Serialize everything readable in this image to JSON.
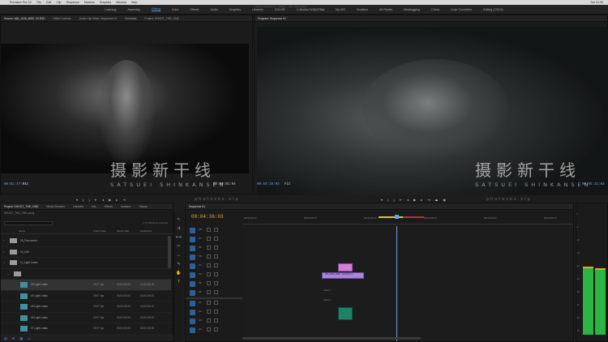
{
  "menubar": {
    "app_name": "Premiere Pro CC",
    "items": [
      "File",
      "Edit",
      "Clip",
      "Sequence",
      "Markers",
      "Graphics",
      "Window",
      "Help"
    ],
    "clock": "Tue 21:06"
  },
  "workspaces": {
    "tabs": [
      "Learning",
      "Assembly",
      "Editing",
      "Color",
      "Effects",
      "Audio",
      "Graphics",
      "Libraries",
      "COLOR",
      "X-Monitor WIDAFINal",
      "My WS",
      "Hoodlum",
      "All Panels",
      "Metalogging",
      "2 Area",
      "Color Correction",
      "Editing (CS5.5)"
    ],
    "active_index": 2,
    "project_path": "/Volumes/Hardrive/../SHOOT_THE_ONE.prproj"
  },
  "source_panel": {
    "tabs": [
      "Source: 486_1006_8000..00.R3D",
      "Effect Controls",
      "Audio Clip Mixer: Sequence 01",
      "Metadata",
      "Project: SHOOT_THE_ONE"
    ],
    "timecode_in": "00:01:47:04",
    "fit": "Fit",
    "timecode_duration": "00:00:01:04"
  },
  "program_panel": {
    "tab": "Program: Sequence 01",
    "timecode": "00:04:36:03",
    "fit": "Fit",
    "timecode_end": "00:05:21:03"
  },
  "watermark": {
    "cn": "摄影新干线",
    "en": "SATSUEI SHINKANSEN",
    "url": "photosks.vip"
  },
  "project_panel": {
    "tabs": [
      "Project: SHOOT_THE_ONE",
      "Media Browser",
      "Libraries",
      "Info",
      "Effects",
      "Markers",
      "History"
    ],
    "path": "SHOOT_THE_ONE.prproj",
    "count": "1 of 108 items selected",
    "columns": [
      "Name",
      "Frame Rate",
      "Media Start",
      "Media End"
    ],
    "rows": [
      {
        "type": "folder",
        "name": "05_Preconvert",
        "fr": "",
        "start": "",
        "end": "",
        "indent": 0
      },
      {
        "type": "folder",
        "name": "10_Edit",
        "fr": "",
        "start": "",
        "end": "",
        "indent": 0
      },
      {
        "type": "folder",
        "name": "11_Light Leaks",
        "fr": "",
        "start": "",
        "end": "",
        "indent": 0
      },
      {
        "type": "folder",
        "name": "",
        "fr": "",
        "start": "",
        "end": "",
        "indent": 1
      },
      {
        "type": "clip",
        "name": "03 Light Leaks",
        "fr": "29.97 fps",
        "start": "00;00;00;00",
        "end": "00;00;05;15",
        "indent": 2
      },
      {
        "type": "clip",
        "name": "04 Light Leaks",
        "fr": "29.97 fps",
        "start": "00;00;00;00",
        "end": "00;00;05;23",
        "indent": 2
      },
      {
        "type": "clip",
        "name": "05 Light Leaks",
        "fr": "29.97 fps",
        "start": "00;00;00;00",
        "end": "00;00;06;10",
        "indent": 2
      },
      {
        "type": "clip",
        "name": "06 Light Leaks",
        "fr": "29.97 fps",
        "start": "00;00;00;00",
        "end": "00;00;05;09",
        "indent": 2
      },
      {
        "type": "clip",
        "name": "07 Light Leaks",
        "fr": "29.97 fps",
        "start": "00;00;00;00",
        "end": "00;00;05;28",
        "indent": 2
      }
    ],
    "selected_row": 4
  },
  "timeline": {
    "tab": "Sequence 01",
    "timecode": "00:04:36:03",
    "ruler_ticks": [
      "00:04:20:17",
      "00:04:26:17",
      "00:04:32:17",
      "00:04:38:17",
      "00:04:44:17",
      "00:04:50:17",
      "00:04:56:17"
    ],
    "video_tracks": [
      "V8",
      "V7",
      "V6",
      "V5",
      "V4",
      "V3",
      "V2",
      "V1"
    ],
    "audio_tracks": [
      "A1",
      "A2",
      "A3",
      "A4",
      "A5",
      "A6",
      "A7"
    ],
    "clip_label": "486_1006_8000...00.R3D [V]",
    "audio_label_1": "Audio 1",
    "audio_label_2": "Audio 2"
  },
  "meters": {
    "scale": [
      "0",
      "-6",
      "-12",
      "-18",
      "-24",
      "-30",
      "-36",
      "-42",
      "-48",
      "-54"
    ],
    "levels": [
      0.62,
      0.6
    ]
  }
}
